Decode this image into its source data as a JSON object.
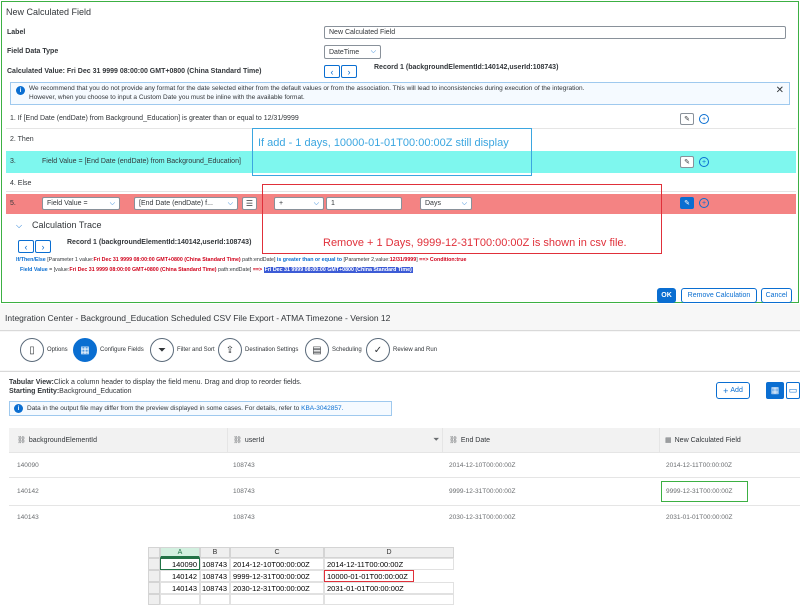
{
  "dialog": {
    "title": "New Calculated Field",
    "label_label": "Label",
    "label_value": "New Calculated Field",
    "data_type_label": "Field Data Type",
    "data_type_value": "DateTime",
    "calc_value": "Calculated Value: Fri Dec 31 9999 08:00:00 GMT+0800 (China Standard Time)",
    "record": "Record 1 (backgroundElementId:140142,userId:108743)",
    "info_line1": "We recommend that you do not provide any format for the date selected either from the default values or from the association. This will lead to inconsistencies during execution of the integration.",
    "info_line2": "However, when you choose to input a Custom Date you must be inline with the available format.",
    "rows": {
      "r1": "1.   If [End Date (endDate) from Background_Education] is greater than or equal to 12/31/9999",
      "r2": "2.   Then",
      "r3_num": "3.",
      "r3_text": "Field Value = [End Date (endDate) from Background_Education]",
      "r4": "4.   Else",
      "r5_num": "5.",
      "r5_field": "Field Value =",
      "r5_source": "[End Date (endDate) f...",
      "r5_op": "+",
      "r5_amount": "1",
      "r5_unit": "Days"
    },
    "callout_blue": "If add - 1 days, 10000-01-01T00:00:00Z still display",
    "callout_red": "Remove + 1 Days, 9999-12-31T00:00:00Z is shown in csv file.",
    "trace_title": "Calculation Trace",
    "trace_record": "Record 1 (backgroundElementId:140142,userId:108743)",
    "trace1": {
      "a": "If/Then/Else",
      "b": " [Parameter 1 value:",
      "c": "Fri Dec 31 9999 08:00:00 GMT+0800 (China Standard Time)",
      "d": " path:endDate] ",
      "e": "is greater than or equal to",
      "f": " [Parameter 2,value:",
      "g": "12/31/9999",
      "h": "] ",
      "i": "==> Condition:true"
    },
    "trace2": {
      "a": "Field Value",
      "b": " = [value:",
      "c": "Fri Dec 31 9999 08:00:00 GMT+0800 (China Standard Time)",
      "d": " path:endDate] ",
      "e": "==>",
      "f": "Fri Dec 31 9999 08:00:00 GMT+0800 (China Standard Time)"
    },
    "ok": "OK",
    "remove": "Remove Calculation",
    "cancel": "Cancel"
  },
  "ic": {
    "header": "Integration Center - Background_Education Scheduled CSV File Export - ATMA Timezone - Version 12",
    "steps": [
      "Options",
      "Configure Fields",
      "Filter and Sort",
      "Destination Settings",
      "Scheduling",
      "Review and Run"
    ],
    "tabular_bold": "Tabular View:",
    "tabular_text": "Click a column header to display the field menu. Drag and drop to reorder fields.",
    "entity_bold": "Starting Entity:",
    "entity_text": "Background_Education",
    "add": "Add",
    "info": "Data in the output file may differ from the preview displayed in some cases. For details, refer to",
    "kba": "KBA-3042857.",
    "columns": [
      "backgroundElementId",
      "userId",
      "End Date",
      "New Calculated Field"
    ],
    "rows": [
      [
        "140090",
        "108743",
        "2014-12-10T00:00:00Z",
        "2014-12-11T00:00:00Z"
      ],
      [
        "140142",
        "108743",
        "9999-12-31T00:00:00Z",
        "9999-12-31T00:00:00Z"
      ],
      [
        "140143",
        "108743",
        "2030-12-31T00:00:00Z",
        "2031-01-01T00:00:00Z"
      ]
    ]
  },
  "excel": {
    "cols": [
      "A",
      "B",
      "C",
      "D"
    ],
    "rows": [
      [
        "140090",
        "108743",
        "2014-12-10T00:00:00Z",
        "2014-12-11T00:00:00Z"
      ],
      [
        "140142",
        "108743",
        "9999-12-31T00:00:00Z",
        "10000-01-01T00:00:00Z"
      ],
      [
        "140143",
        "108743",
        "2030-12-31T00:00:00Z",
        "2031-01-01T00:00:00Z"
      ]
    ]
  }
}
